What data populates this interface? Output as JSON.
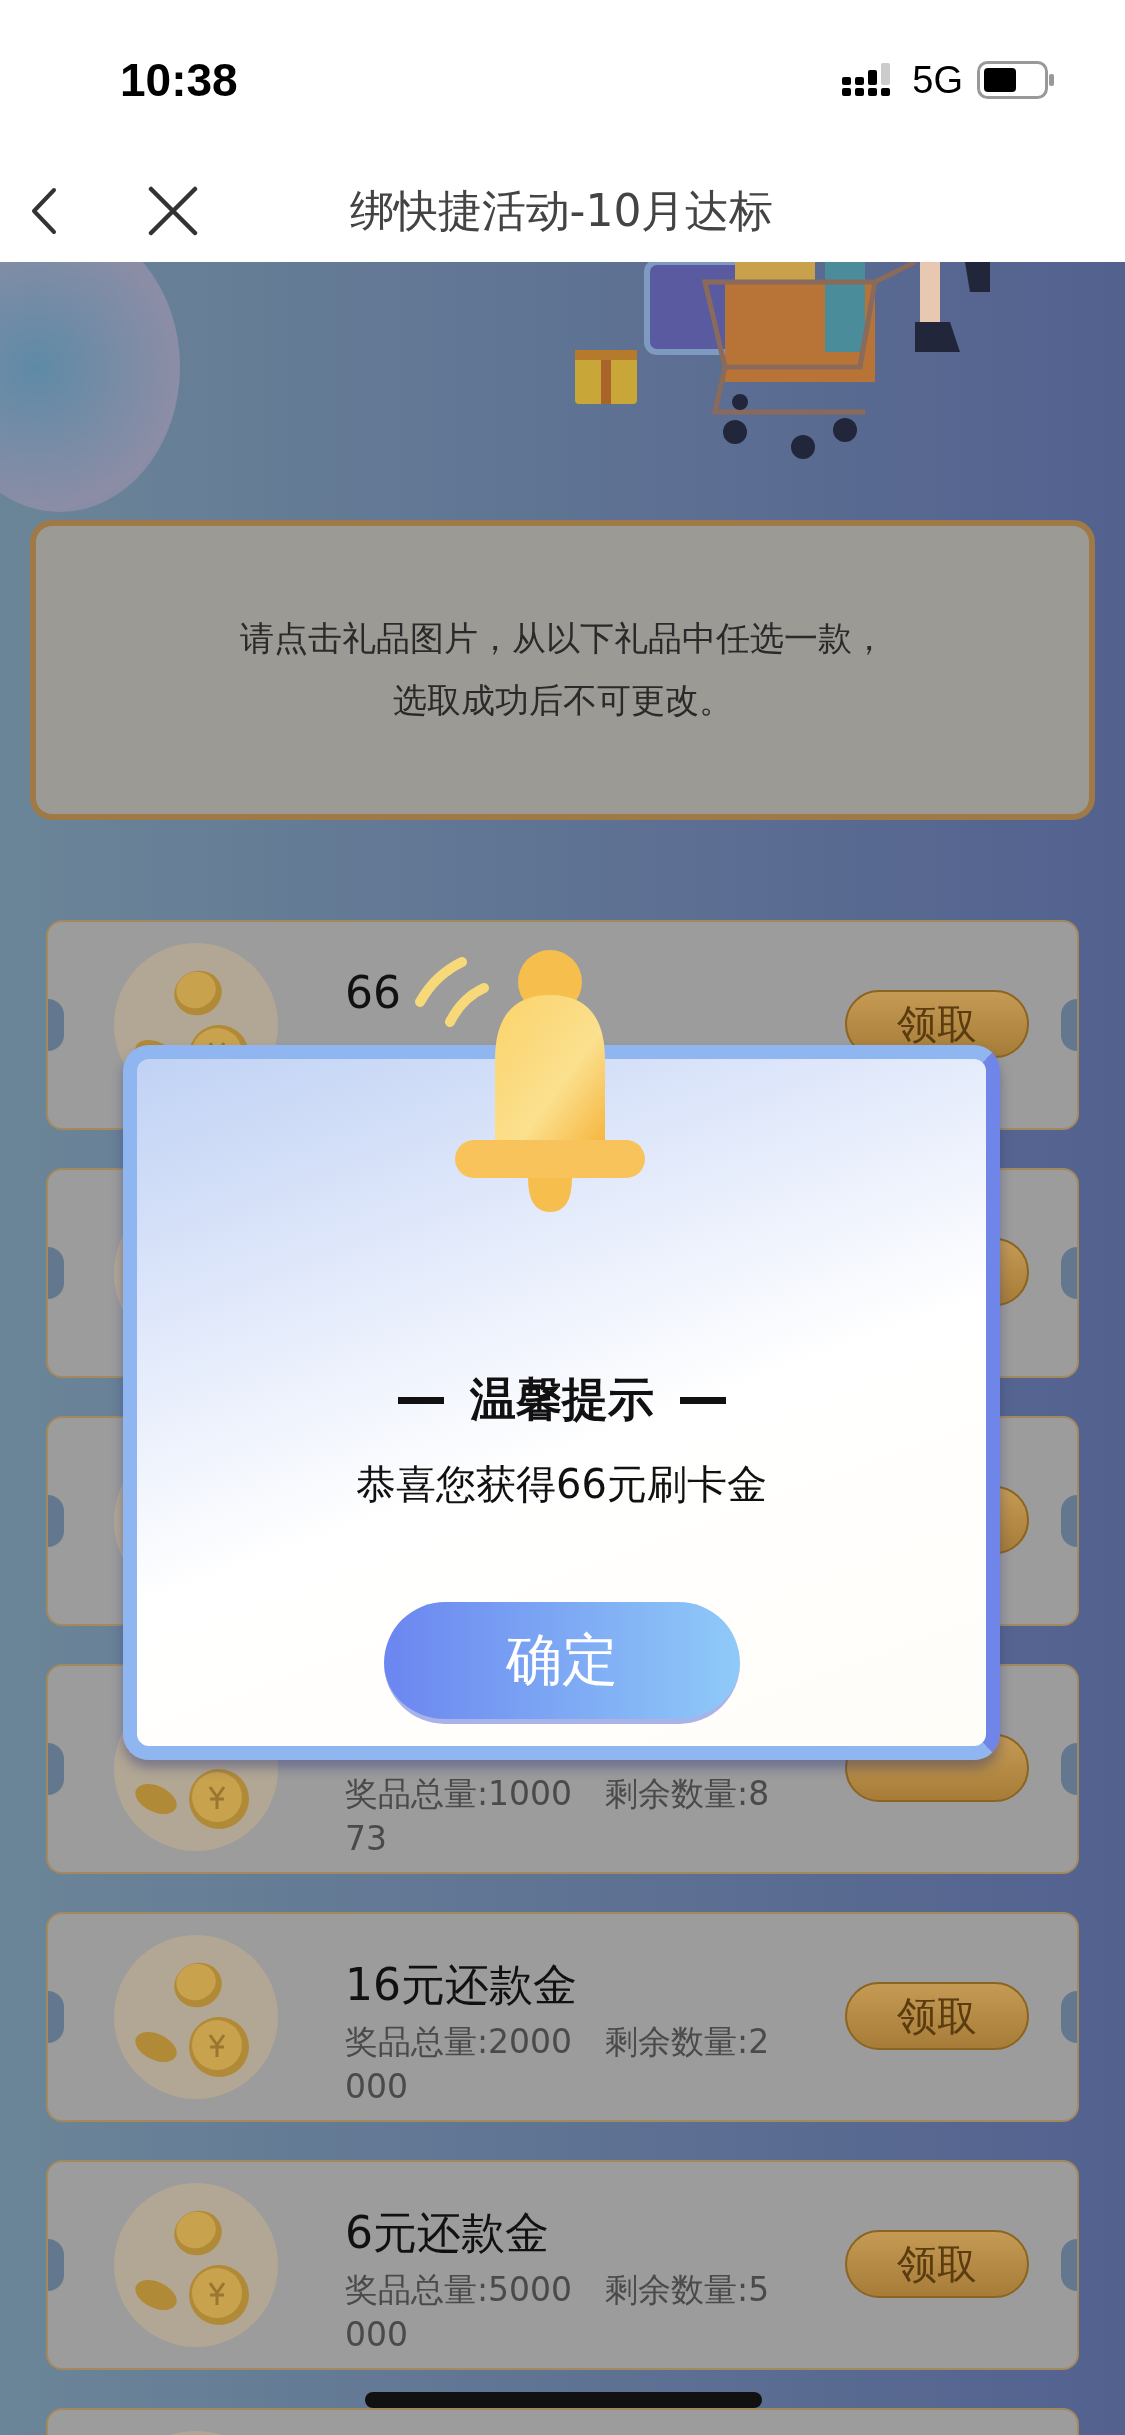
{
  "status_bar": {
    "time": "10:38",
    "network": "5G"
  },
  "nav_bar": {
    "title": "绑快捷活动-10月达标"
  },
  "notice": {
    "lines": [
      "请点击礼品图片，从以下礼品中任选一款，",
      "选取成功后不可更改。"
    ]
  },
  "prizes": [
    {
      "kind": "prize",
      "title": "66",
      "button_label": "领取"
    },
    {
      "kind": "prize"
    },
    {
      "kind": "prize"
    },
    {
      "kind": "prize",
      "details": "奖品总量:1000　剩余数量:873"
    },
    {
      "kind": "prize",
      "title": "16元还款金",
      "details": "奖品总量:2000　剩余数量:2000",
      "button_label": "领取"
    },
    {
      "kind": "prize",
      "title": "6元还款金",
      "details": "奖品总量:5000　剩余数量:5000",
      "button_label": "领取"
    },
    {
      "kind": "prize"
    }
  ],
  "dialog": {
    "title": "温馨提示",
    "message": "恭喜您获得66元刷卡金",
    "confirm_label": "确定"
  }
}
